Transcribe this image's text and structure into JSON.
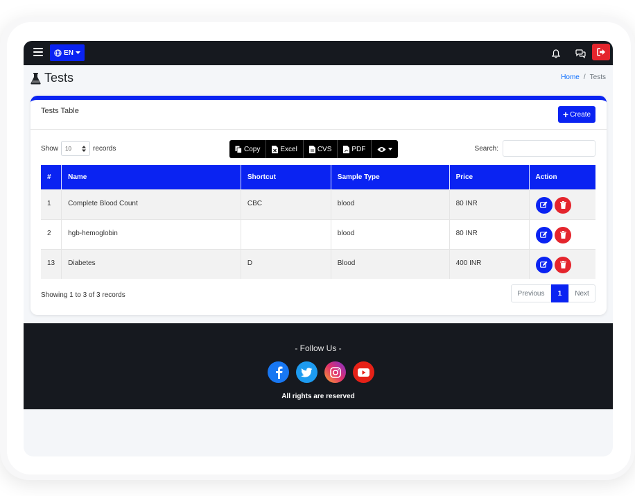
{
  "navbar": {
    "language": "EN",
    "icons": [
      "menu-icon",
      "globe-icon",
      "bell-icon",
      "chat-icon",
      "logout-icon"
    ]
  },
  "header": {
    "title": "Tests",
    "breadcrumb": {
      "home": "Home",
      "separator": "/",
      "current": "Tests"
    }
  },
  "card": {
    "title": "Tests Table",
    "create_label": "Create",
    "show_label": "Show",
    "show_value": "10",
    "records_label": "records",
    "search_label": "Search:",
    "search_value": "",
    "export": {
      "copy": "Copy",
      "excel": "Excel",
      "cvs": "CVS",
      "pdf": "PDF"
    },
    "table": {
      "headers": [
        "#",
        "Name",
        "Shortcut",
        "Sample Type",
        "Price",
        "Action"
      ],
      "rows": [
        {
          "id": "1",
          "name": "Complete Blood Count",
          "shortcut": "CBC",
          "sample": "blood",
          "price": "80 INR"
        },
        {
          "id": "2",
          "name": "hgb-hemoglobin",
          "shortcut": "",
          "sample": "blood",
          "price": "80 INR"
        },
        {
          "id": "13",
          "name": "Diabetes",
          "shortcut": "D",
          "sample": "Blood",
          "price": "400 INR"
        }
      ]
    },
    "info": "Showing 1 to 3 of 3 records",
    "pagination": {
      "previous": "Previous",
      "current": "1",
      "next": "Next"
    }
  },
  "footer": {
    "follow": "- Follow Us -",
    "rights": "All rights are reserved",
    "socials": [
      "facebook-icon",
      "twitter-icon",
      "instagram-icon",
      "youtube-icon"
    ]
  },
  "colors": {
    "primary": "#0a23f2",
    "danger": "#e4252d",
    "navbar": "#16191f"
  }
}
